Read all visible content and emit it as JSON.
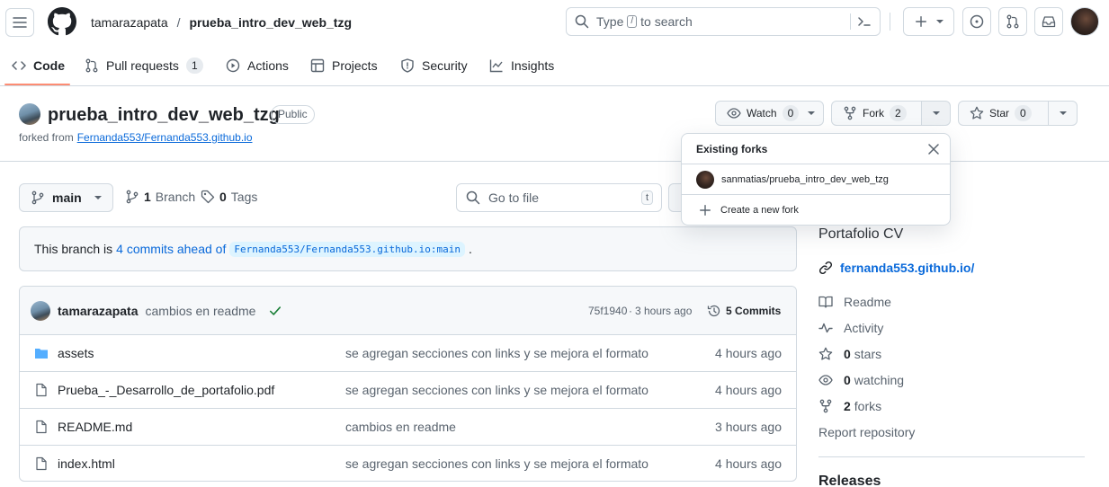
{
  "header": {
    "owner": "tamarazapata",
    "separator": "/",
    "repo": "prueba_intro_dev_web_tzg",
    "search": {
      "prefix": "Type",
      "key": "/",
      "suffix": "to search"
    }
  },
  "tabs": [
    {
      "label": "Code"
    },
    {
      "label": "Pull requests",
      "count": "1"
    },
    {
      "label": "Actions"
    },
    {
      "label": "Projects"
    },
    {
      "label": "Security"
    },
    {
      "label": "Insights"
    }
  ],
  "repo": {
    "name": "prueba_intro_dev_web_tzg",
    "visibility": "Public",
    "forked_from_label": "forked from",
    "forked_from": "Fernanda553/Fernanda553.github.io",
    "watch": {
      "label": "Watch",
      "count": "0"
    },
    "fork": {
      "label": "Fork",
      "count": "2"
    },
    "star": {
      "label": "Star",
      "count": "0"
    }
  },
  "forks_popup": {
    "title": "Existing forks",
    "items": [
      "sanmatias/prueba_intro_dev_web_tzg"
    ],
    "create": "Create a new fork"
  },
  "branch_bar": {
    "branch": "main",
    "branches": {
      "count": "1",
      "label": "Branch"
    },
    "tags": {
      "count": "0",
      "label": "Tags"
    },
    "go_to_file": "Go to file",
    "shortcut": "t"
  },
  "ahead_notice": {
    "prefix": "This branch is",
    "link": "4 commits ahead of",
    "ref": "Fernanda553/Fernanda553.github.io:main",
    "suffix": "."
  },
  "latest_commit": {
    "author": "tamarazapata",
    "message": "cambios en readme",
    "hash": "75f1940",
    "dot": "·",
    "time": "3 hours ago",
    "commits": "5 Commits"
  },
  "files": [
    {
      "name": "assets",
      "type": "folder",
      "message": "se agregan secciones con links y se mejora el formato",
      "time": "4 hours ago"
    },
    {
      "name": "Prueba_-_Desarrollo_de_portafolio.pdf",
      "type": "file",
      "message": "se agregan secciones con links y se mejora el formato",
      "time": "4 hours ago"
    },
    {
      "name": "README.md",
      "type": "file",
      "message": "cambios en readme",
      "time": "3 hours ago"
    },
    {
      "name": "index.html",
      "type": "file",
      "message": "se agregan secciones con links y se mejora el formato",
      "time": "4 hours ago"
    }
  ],
  "about": {
    "description": "Portafolio CV",
    "website": "fernanda553.github.io/",
    "readme": "Readme",
    "activity": "Activity",
    "stars": {
      "count": "0",
      "label": "stars"
    },
    "watching": {
      "count": "0",
      "label": "watching"
    },
    "forks": {
      "count": "2",
      "label": "forks"
    },
    "report": "Report repository",
    "releases": "Releases"
  },
  "colors": {
    "accent": "#0969da",
    "tab_underline": "#fd8c73",
    "success": "#1a7f37",
    "folder": "#54aeff"
  }
}
